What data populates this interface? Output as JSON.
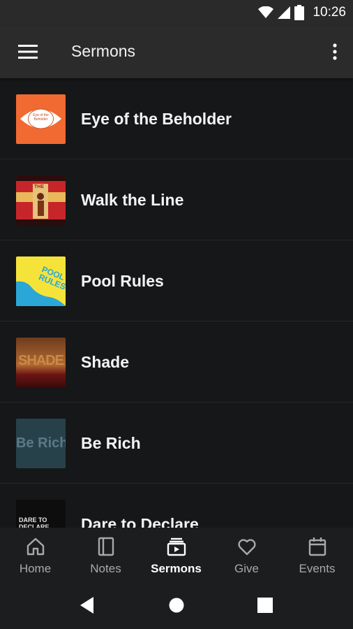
{
  "status_bar": {
    "time": "10:26"
  },
  "app_bar": {
    "title": "Sermons"
  },
  "sermons": [
    {
      "title": "Eye of the Beholder",
      "thumb_text": "Eye of the Beholder"
    },
    {
      "title": "Walk the Line",
      "thumb_text": "THE"
    },
    {
      "title": "Pool Rules",
      "thumb_text": "POOL RULES"
    },
    {
      "title": "Shade",
      "thumb_text": "SHADE"
    },
    {
      "title": "Be Rich",
      "thumb_text": "Be Rich"
    },
    {
      "title": "Dare to Declare",
      "thumb_text": "DARE TO DECLARE"
    }
  ],
  "bottom_nav": [
    {
      "label": "Home",
      "icon": "home-icon"
    },
    {
      "label": "Notes",
      "icon": "notes-icon"
    },
    {
      "label": "Sermons",
      "icon": "sermons-icon",
      "active": true
    },
    {
      "label": "Give",
      "icon": "heart-icon"
    },
    {
      "label": "Events",
      "icon": "calendar-icon"
    }
  ],
  "colors": {
    "background": "#161718",
    "app_bar": "#2b2b2c",
    "nav_active": "#ffffff",
    "nav_inactive": "#a9a9a9"
  }
}
